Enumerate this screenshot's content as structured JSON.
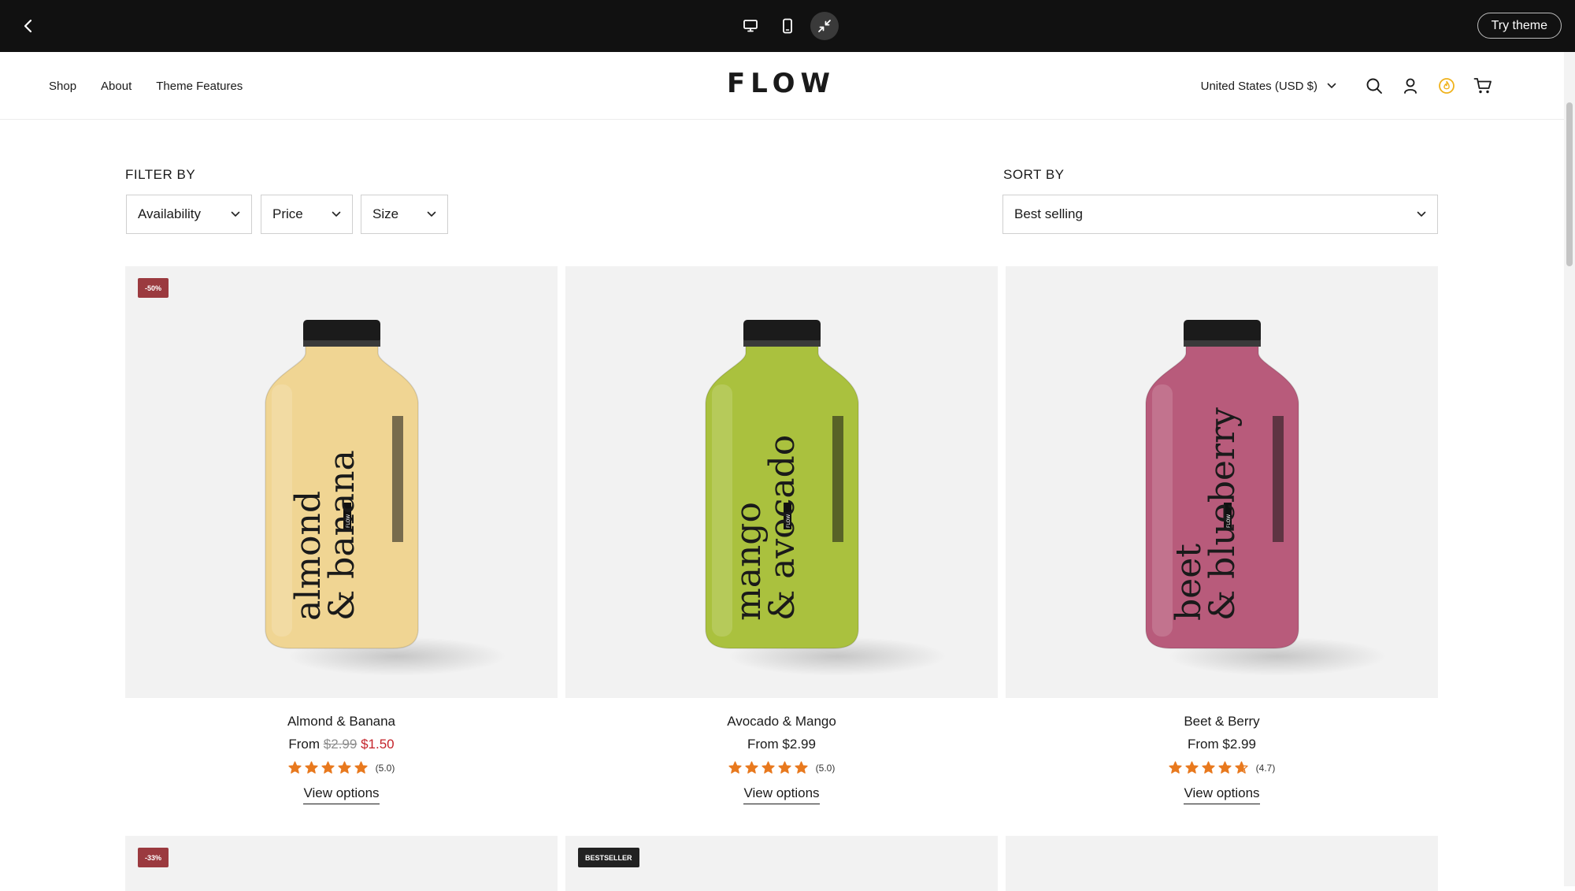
{
  "preview_bar": {
    "try_label": "Try theme"
  },
  "header": {
    "nav": [
      "Shop",
      "About",
      "Theme Features"
    ],
    "logo": "FLOW",
    "country": "United States (USD $)"
  },
  "filters": {
    "filter_title": "FILTER BY",
    "sort_title": "SORT BY",
    "availability": "Availability",
    "price": "Price",
    "size": "Size",
    "sort_value": "Best selling"
  },
  "products": [
    {
      "badge": "-50%",
      "name": "Almond & Banana",
      "price_prefix": "From",
      "old_price": "$2.99",
      "price": "$1.50",
      "rating": "(5.0)",
      "rating_value": 5.0,
      "cta": "View options",
      "label_top": "almond",
      "label_bottom": "& banana",
      "bottle_color": "#f0d593",
      "brand": "FLOW"
    },
    {
      "name": "Avocado & Mango",
      "price_prefix": "From",
      "price": "$2.99",
      "rating": "(5.0)",
      "rating_value": 5.0,
      "cta": "View options",
      "label_top": "mango",
      "label_bottom": "& avocado",
      "bottle_color": "#aac13e",
      "brand": "FLOW"
    },
    {
      "name": "Beet & Berry",
      "price_prefix": "From",
      "price": "$2.99",
      "rating": "(4.7)",
      "rating_value": 4.7,
      "cta": "View options",
      "label_top": "beet",
      "label_bottom": "& blueberry",
      "bottle_color": "#b85b7b",
      "brand": "FLOW"
    }
  ],
  "next_row": [
    {
      "badge": "-33%"
    },
    {
      "badge": "BESTSELLER"
    },
    {
      "badge": ""
    }
  ],
  "colors": {
    "sale_red": "#c4232a",
    "badge_red": "#9b3a3f",
    "star_orange": "#e8791e",
    "topbar": "#111111"
  }
}
